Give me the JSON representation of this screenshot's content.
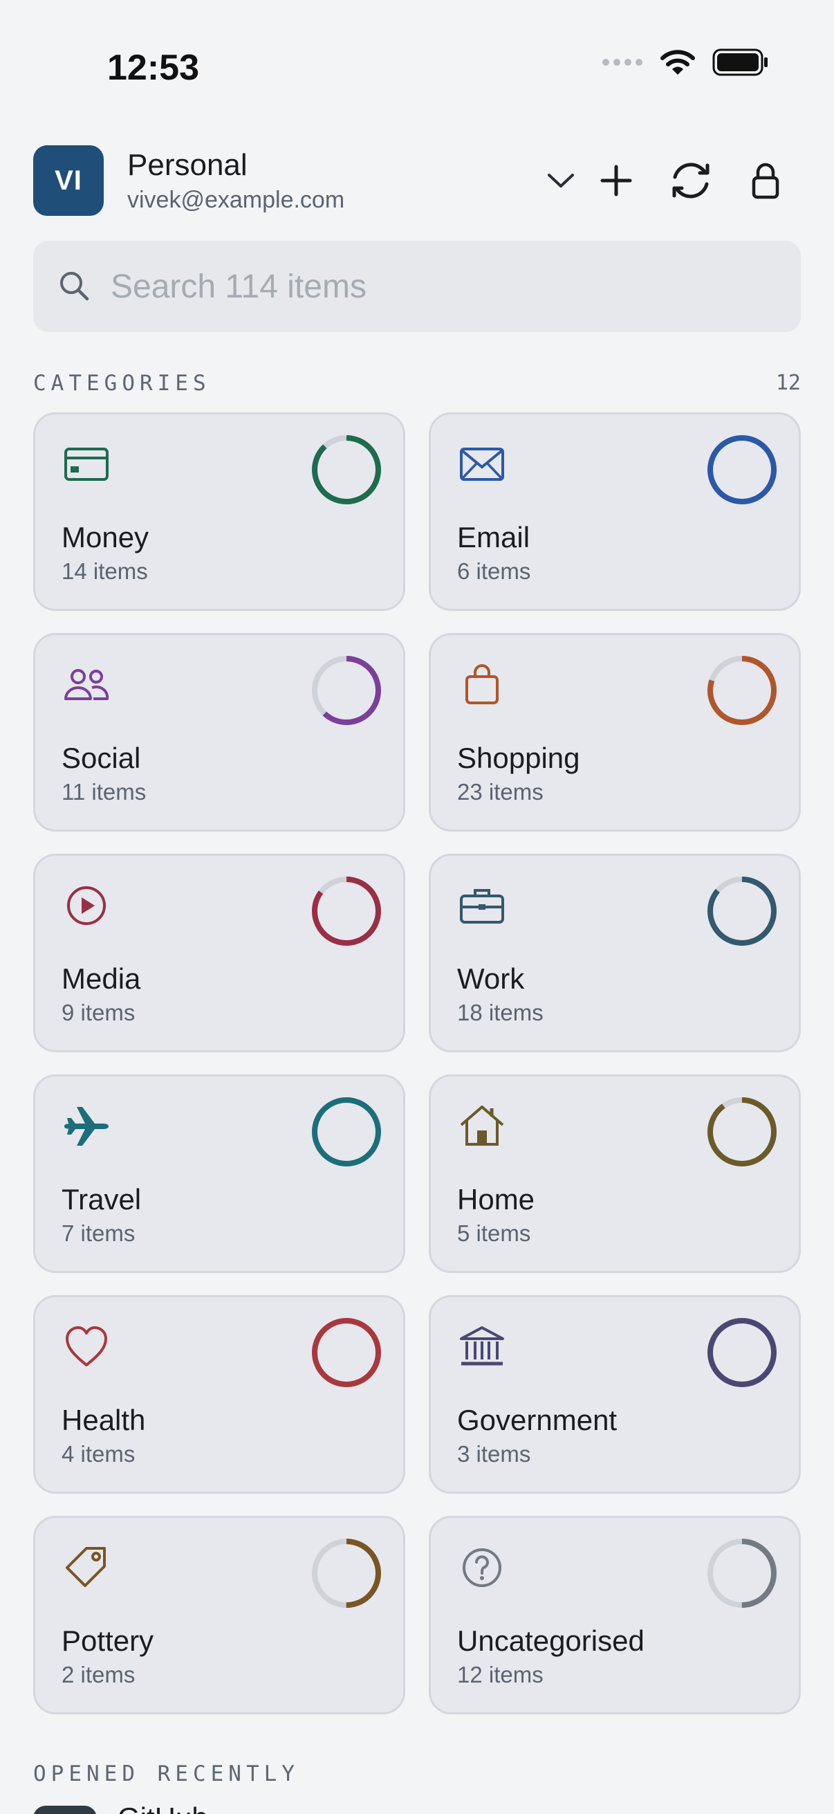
{
  "status_bar": {
    "time": "12:53"
  },
  "account": {
    "initials": "VI",
    "name": "Personal",
    "email": "vivek@example.com",
    "avatar_color": "#1f4e78"
  },
  "search": {
    "placeholder": "Search 114 items"
  },
  "categories": {
    "label": "CATEGORIES",
    "count": "12",
    "items": [
      {
        "name": "Money",
        "count": "14 items",
        "icon": "card-icon",
        "color": "#1e6b4e",
        "progress": 0.88
      },
      {
        "name": "Email",
        "count": "6 items",
        "icon": "envelope-icon",
        "color": "#2b59a8",
        "progress": 1.0
      },
      {
        "name": "Social",
        "count": "11 items",
        "icon": "people-icon",
        "color": "#7b3f9a",
        "progress": 0.62
      },
      {
        "name": "Shopping",
        "count": "23 items",
        "icon": "bag-icon",
        "color": "#b0562a",
        "progress": 0.8
      },
      {
        "name": "Media",
        "count": "9 items",
        "icon": "play-icon",
        "color": "#9a2e45",
        "progress": 0.85
      },
      {
        "name": "Work",
        "count": "18 items",
        "icon": "briefcase-icon",
        "color": "#34586e",
        "progress": 0.86
      },
      {
        "name": "Travel",
        "count": "7 items",
        "icon": "airplane-icon",
        "color": "#1c6e7a",
        "progress": 1.0
      },
      {
        "name": "Home",
        "count": "5 items",
        "icon": "house-icon",
        "color": "#6b5a2a",
        "progress": 0.9
      },
      {
        "name": "Health",
        "count": "4 items",
        "icon": "heart-icon",
        "color": "#a8383d",
        "progress": 1.0
      },
      {
        "name": "Government",
        "count": "3 items",
        "icon": "bank-icon",
        "color": "#4a4872",
        "progress": 1.0
      },
      {
        "name": "Pottery",
        "count": "2 items",
        "icon": "tag-icon",
        "color": "#7a5524",
        "progress": 0.5
      },
      {
        "name": "Uncategorised",
        "count": "12 items",
        "icon": "question-icon",
        "color": "#747982",
        "progress": 0.5
      }
    ]
  },
  "recent": {
    "label": "OPENED RECENTLY",
    "items": [
      {
        "name": "GitHub"
      }
    ]
  }
}
